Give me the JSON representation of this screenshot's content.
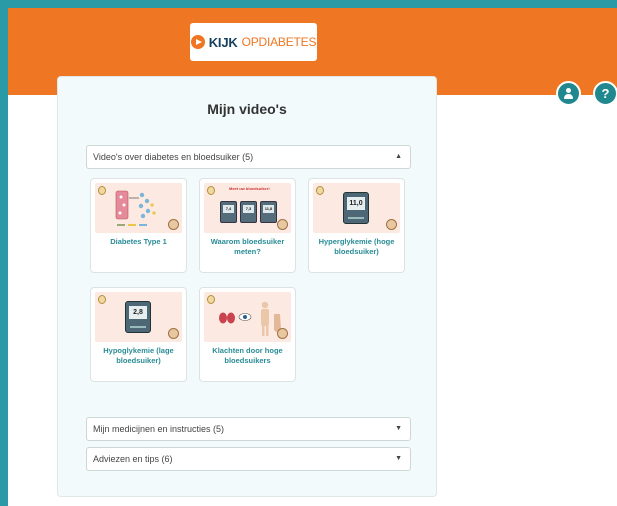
{
  "header": {
    "logo_part1": "KIJK",
    "logo_part2": "OPDIABETES",
    "user_icon": "user-icon",
    "help_label": "?"
  },
  "panel": {
    "title": "Mijn video's",
    "sections": [
      {
        "label": "Video's over diabetes en bloedsuiker (5)",
        "expanded": true
      },
      {
        "label": "Mijn medicijnen en instructies (5)",
        "expanded": false
      },
      {
        "label": "Adviezen en tips (6)",
        "expanded": false
      }
    ],
    "videos": [
      {
        "title": "Diabetes Type 1"
      },
      {
        "title": "Waarom bloedsuiker meten?",
        "thumb_text": "Meet uw bloedsuiker!",
        "meter_values": [
          "7,4",
          "7,3",
          "11,8"
        ]
      },
      {
        "title": "Hyperglykemie (hoge bloedsuiker)",
        "meter_value": "11,0"
      },
      {
        "title": "Hypoglykemie (lage bloedsuiker)",
        "meter_value": "2,8"
      },
      {
        "title": "Klachten door hoge bloedsuikers"
      }
    ]
  },
  "colors": {
    "page_border": "#2a9aa6",
    "header_orange": "#ef7622",
    "accent_teal": "#2a8c96",
    "logo_navy": "#153f5c"
  }
}
